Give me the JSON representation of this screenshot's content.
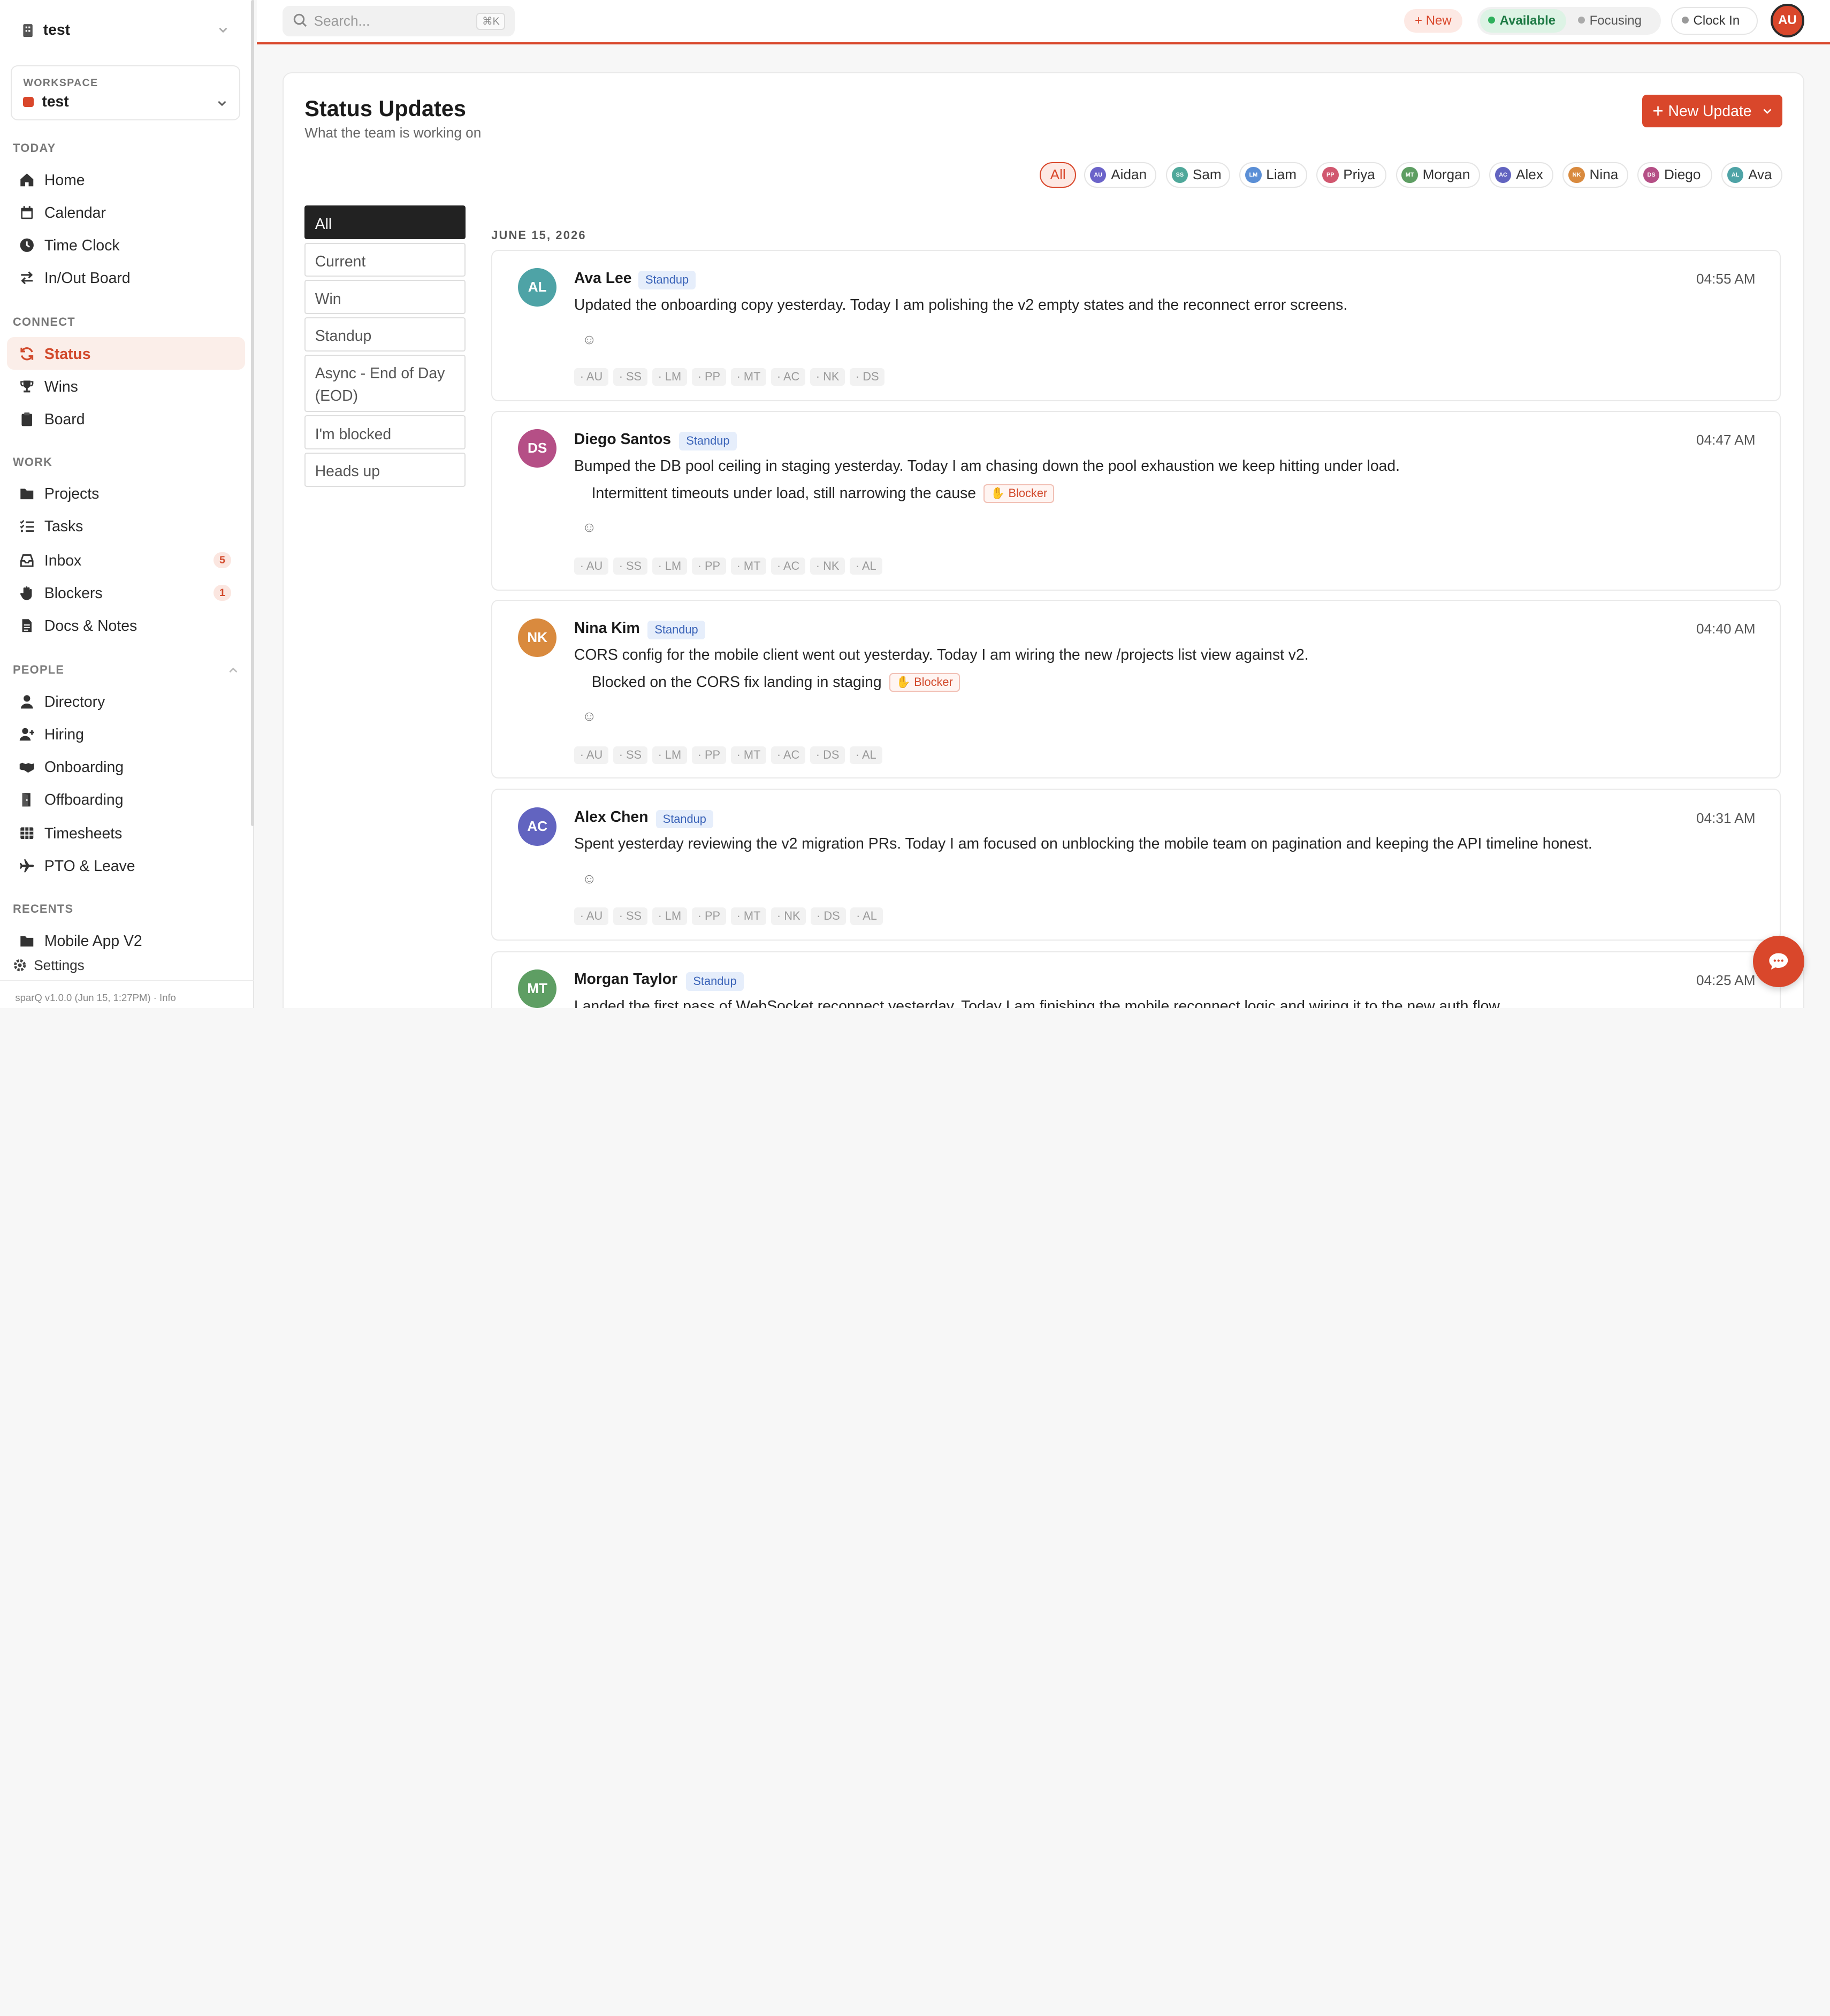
{
  "workspace_top": {
    "name": "test"
  },
  "workspace_card": {
    "label": "WORKSPACE",
    "name": "test"
  },
  "sidebar": {
    "sections": {
      "today": "TODAY",
      "connect": "CONNECT",
      "work": "WORK",
      "people": "PEOPLE",
      "recents": "RECENTS"
    },
    "today": [
      {
        "label": "Home",
        "icon": "home-icon"
      },
      {
        "label": "Calendar",
        "icon": "calendar-icon"
      },
      {
        "label": "Time Clock",
        "icon": "clock-icon"
      },
      {
        "label": "In/Out Board",
        "icon": "swap-icon"
      }
    ],
    "connect": [
      {
        "label": "Status",
        "icon": "refresh-icon",
        "active": true
      },
      {
        "label": "Wins",
        "icon": "trophy-icon"
      },
      {
        "label": "Board",
        "icon": "clipboard-icon"
      }
    ],
    "work": [
      {
        "label": "Projects",
        "icon": "folder-icon"
      },
      {
        "label": "Tasks",
        "icon": "list-check-icon"
      },
      {
        "label": "Inbox",
        "icon": "inbox-icon",
        "count": "5"
      },
      {
        "label": "Blockers",
        "icon": "hand-icon",
        "count": "1"
      },
      {
        "label": "Docs & Notes",
        "icon": "document-icon"
      }
    ],
    "people": [
      {
        "label": "Directory",
        "icon": "user-icon"
      },
      {
        "label": "Hiring",
        "icon": "user-plus-icon"
      },
      {
        "label": "Onboarding",
        "icon": "handshake-icon"
      },
      {
        "label": "Offboarding",
        "icon": "door-icon"
      },
      {
        "label": "Timesheets",
        "icon": "table-icon"
      },
      {
        "label": "PTO & Leave",
        "icon": "plane-icon"
      }
    ],
    "recents": [
      {
        "label": "Mobile App V2",
        "icon": "folder-icon"
      }
    ],
    "settings": "Settings",
    "footer": "sparQ v1.0.0 (Jun 15, 1:27PM) · Info"
  },
  "topbar": {
    "search_placeholder": "Search...",
    "search_shortcut": "⌘K",
    "new_label": "+ New",
    "available_label": "Available",
    "focusing_label": "Focusing",
    "clock_in_label": "Clock In",
    "avatar_initials": "AU"
  },
  "page": {
    "title": "Status Updates",
    "subtitle": "What the team is working on",
    "new_update_label": "New Update"
  },
  "people_filter": [
    {
      "label": "All"
    },
    {
      "label": "Aidan",
      "initials": "AU",
      "color": "#6b63c9"
    },
    {
      "label": "Sam",
      "initials": "SS",
      "color": "#4fa89a"
    },
    {
      "label": "Liam",
      "initials": "LM",
      "color": "#5b8fd6"
    },
    {
      "label": "Priya",
      "initials": "PP",
      "color": "#d1576f"
    },
    {
      "label": "Morgan",
      "initials": "MT",
      "color": "#5e9e63"
    },
    {
      "label": "Alex",
      "initials": "AC",
      "color": "#6264c0"
    },
    {
      "label": "Nina",
      "initials": "NK",
      "color": "#d98a3e"
    },
    {
      "label": "Diego",
      "initials": "DS",
      "color": "#b54f86"
    },
    {
      "label": "Ava",
      "initials": "AL",
      "color": "#4ea3a6"
    }
  ],
  "type_filters": [
    "All",
    "Current",
    "Win",
    "Standup",
    "Async - End of Day (EOD)",
    "I'm blocked",
    "Heads up"
  ],
  "date_heading": "JUNE 15, 2026",
  "posts": [
    {
      "initials": "AL",
      "color": "#4ea3a6",
      "name": "Ava Lee",
      "tag": "Standup",
      "time": "04:55 AM",
      "body": "Updated the onboarding copy yesterday. Today I am polishing the v2 empty states and the reconnect error screens.",
      "sub": "",
      "blocker": "",
      "seen": [
        "· AU",
        "· SS",
        "· LM",
        "· PP",
        "· MT",
        "· AC",
        "· NK",
        "· DS"
      ]
    },
    {
      "initials": "DS",
      "color": "#b54f86",
      "name": "Diego Santos",
      "tag": "Standup",
      "time": "04:47 AM",
      "body": "Bumped the DB pool ceiling in staging yesterday. Today I am chasing down the pool exhaustion we keep hitting under load.",
      "sub": "Intermittent timeouts under load, still narrowing the cause",
      "blocker": "Blocker",
      "seen": [
        "· AU",
        "· SS",
        "· LM",
        "· PP",
        "· MT",
        "· AC",
        "· NK",
        "· AL"
      ]
    },
    {
      "initials": "NK",
      "color": "#d98a3e",
      "name": "Nina Kim",
      "tag": "Standup",
      "time": "04:40 AM",
      "body": "CORS config for the mobile client went out yesterday. Today I am wiring the new /projects list view against v2.",
      "sub": "Blocked on the CORS fix landing in staging",
      "blocker": "Blocker",
      "seen": [
        "· AU",
        "· SS",
        "· LM",
        "· PP",
        "· MT",
        "· AC",
        "· DS",
        "· AL"
      ]
    },
    {
      "initials": "AC",
      "color": "#6264c0",
      "name": "Alex Chen",
      "tag": "Standup",
      "time": "04:31 AM",
      "body": "Spent yesterday reviewing the v2 migration PRs. Today I am focused on unblocking the mobile team on pagination and keeping the API timeline honest.",
      "sub": "",
      "blocker": "",
      "seen": [
        "· AU",
        "· SS",
        "· LM",
        "· PP",
        "· MT",
        "· NK",
        "· DS",
        "· AL"
      ]
    },
    {
      "initials": "MT",
      "color": "#5e9e63",
      "name": "Morgan Taylor",
      "tag": "Standup",
      "time": "04:25 AM",
      "body": "Landed the first pass of WebSocket reconnect yesterday. Today I am finishing the mobile reconnect logic and wiring it to the new auth flow.",
      "sub": "",
      "blocker": "",
      "seen": []
    }
  ]
}
